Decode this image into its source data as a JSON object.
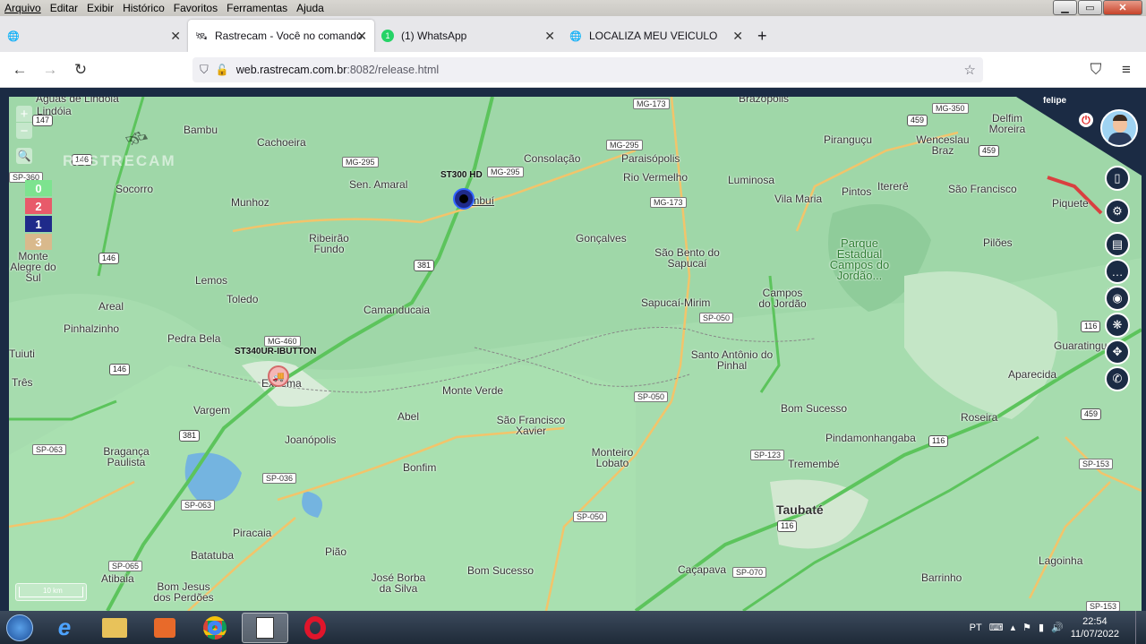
{
  "menu": [
    "Arquivo",
    "Editar",
    "Exibir",
    "Histórico",
    "Favoritos",
    "Ferramentas",
    "Ajuda"
  ],
  "tabs": [
    {
      "label": "",
      "icon": "globe-icon"
    },
    {
      "label": "Rastrecam - Você no comando",
      "icon": "satellite-icon"
    },
    {
      "label": "(1) WhatsApp",
      "icon": "whatsapp-icon",
      "badge": "1"
    },
    {
      "label": "LOCALIZA MEU VEICULO",
      "icon": "globe-icon"
    }
  ],
  "url": {
    "domain": "web.rastrecam.com.br",
    "rest": ":8082/release.html"
  },
  "user": {
    "name": "felipe"
  },
  "map": {
    "watermark": "RASTRECAM",
    "scale": "10 km",
    "legend": [
      {
        "value": "0",
        "color": "#7de38f"
      },
      {
        "value": "2",
        "color": "#e85a6a"
      },
      {
        "value": "1",
        "color": "#1f2a8a"
      },
      {
        "value": "3",
        "color": "#d9b98c"
      }
    ],
    "vehicles": [
      {
        "label": "ST300 HD",
        "color": "#1f2a8a"
      },
      {
        "label": "ST340UR-IBUTTON",
        "color": "#f4b6b6"
      }
    ],
    "places": [
      "Águas de Lindóia",
      "Lindóia",
      "Bambu",
      "Cachoeira",
      "Sen. Amaral",
      "Cambuí",
      "Consolação",
      "Paraisópolis",
      "Rio Vermelho",
      "Luminosa",
      "Piranguçu",
      "Wenceslau Braz",
      "Delfim Moreira",
      "Socorro",
      "Munhoz",
      "Ribeirão Fundo",
      "Gonçalves",
      "São Bento do Sapucaí",
      "Vila Maria",
      "Pintos",
      "Itererê",
      "São Francisco",
      "Piquete",
      "Monte Alegre do Sul",
      "Lemos",
      "Toledo",
      "Pilões",
      "Parque Estadual Campos do Jordão...",
      "Areal",
      "Camanducaia",
      "Sapucaí-Mirim",
      "Campos do Jordão",
      "Pinhalzinho",
      "Pedra Bela",
      "Tuiuti",
      "Extrema",
      "Santo Antônio do Pinhal",
      "Guaratinguetá",
      "Três",
      "Monte Verde",
      "Aparecida",
      "Vargem",
      "Abel",
      "São Francisco Xavier",
      "Bom Sucesso",
      "Roseira",
      "Bragança Paulista",
      "Joanópolis",
      "Pindamonhangaba",
      "Bonfim",
      "Monteiro Lobato",
      "Tremembé",
      "Taubaté",
      "Piracaia",
      "Batatuba",
      "Pião",
      "Bom Sucesso",
      "Caçapava",
      "Atibaia",
      "Bom Jesus dos Perdões",
      "José Borba da Silva",
      "Barrinho",
      "Lagoinha",
      "Brazópolis",
      "Lo"
    ],
    "roads": [
      "MG-173",
      "MG-350",
      "MG-295",
      "MG-295",
      "MG-295",
      "MG-173",
      "146",
      "459",
      "459",
      "146",
      "381",
      "MG-460",
      "SP-050",
      "146",
      "381",
      "SP-050",
      "SP-063",
      "SP-036",
      "SP-063",
      "SP-123",
      "SP-050",
      "116",
      "SP-065",
      "SP-070",
      "116",
      "459",
      "116",
      "SP-153",
      "SP-360",
      "147",
      "SP-153",
      "SP-123"
    ]
  },
  "side_buttons": [
    "map-icon",
    "share-icon",
    "report-icon",
    "chat-icon",
    "target-icon",
    "paw-icon",
    "crosshair-icon",
    "whatsapp-icon"
  ],
  "taskbar": {
    "lang": "PT",
    "time": "22:54",
    "date": "11/07/2022"
  }
}
